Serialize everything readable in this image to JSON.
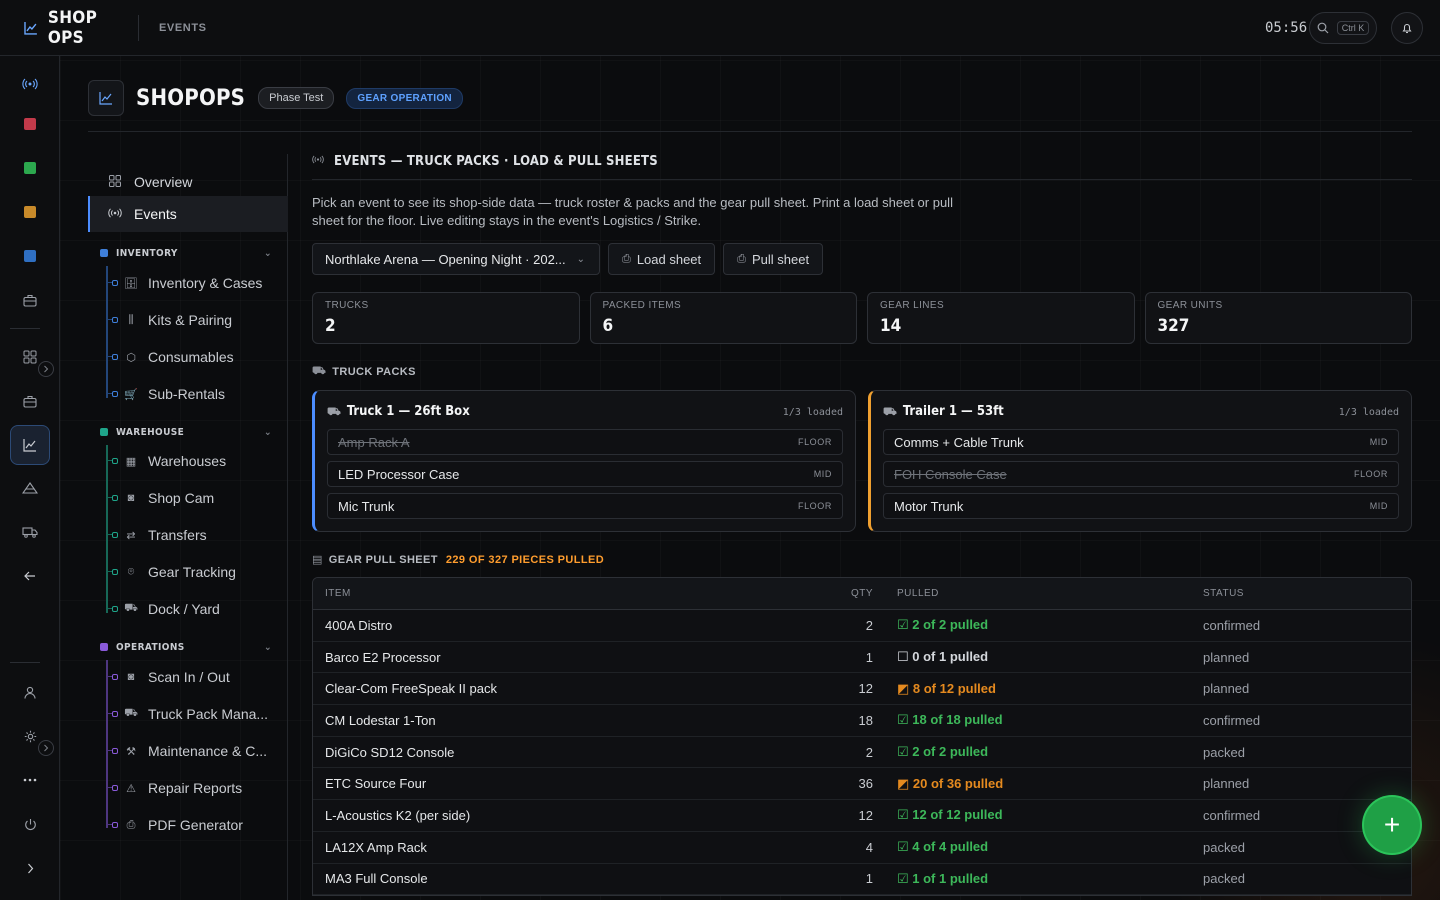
{
  "app": {
    "name": "SHOP OPS",
    "breadcrumb": "EVENTS",
    "clock": "05:56",
    "search_kbd": "Ctrl K"
  },
  "header": {
    "title": "SHOPOPS",
    "chip": "Phase Test",
    "badge": "GEAR OPERATION"
  },
  "nav": {
    "top": [
      {
        "label": "Overview",
        "icon": "grid-icon"
      },
      {
        "label": "Events",
        "icon": "broadcast-icon"
      }
    ],
    "groups": [
      {
        "label": "INVENTORY",
        "color": "#3f7fd9",
        "items": [
          "Inventory & Cases",
          "Kits & Pairing",
          "Consumables",
          "Sub-Rentals"
        ]
      },
      {
        "label": "WAREHOUSE",
        "color": "#1fa58a",
        "items": [
          "Warehouses",
          "Shop Cam",
          "Transfers",
          "Gear Tracking",
          "Dock / Yard"
        ]
      },
      {
        "label": "OPERATIONS",
        "color": "#8a5ad9",
        "items": [
          "Scan In / Out",
          "Truck Pack Mana...",
          "Maintenance & C...",
          "Repair Reports",
          "PDF Generator"
        ]
      }
    ]
  },
  "section": {
    "title": "EVENTS — TRUCK PACKS · LOAD & PULL SHEETS",
    "description": "Pick an event to see its shop-side data — truck roster & packs and the gear pull sheet. Print a load sheet or pull sheet for the floor. Live editing stays in the event's Logistics / Strike.",
    "event_select": "Northlake Arena — Opening Night · 202...",
    "load_sheet": "Load sheet",
    "pull_sheet": "Pull sheet"
  },
  "stats": [
    {
      "label": "TRUCKS",
      "value": "2"
    },
    {
      "label": "PACKED ITEMS",
      "value": "6"
    },
    {
      "label": "GEAR LINES",
      "value": "14"
    },
    {
      "label": "GEAR UNITS",
      "value": "327"
    }
  ],
  "truck_packs": {
    "label": "TRUCK PACKS",
    "trucks": [
      {
        "name": "Truck 1 — 26ft Box",
        "count": "1/3 loaded",
        "cases": [
          {
            "name": "Amp Rack A",
            "pos": "FLOOR",
            "loaded": true
          },
          {
            "name": "LED Processor Case",
            "pos": "MID",
            "loaded": false
          },
          {
            "name": "Mic Trunk",
            "pos": "FLOOR",
            "loaded": false
          }
        ]
      },
      {
        "name": "Trailer 1 — 53ft",
        "count": "1/3 loaded",
        "cases": [
          {
            "name": "Comms + Cable Trunk",
            "pos": "MID",
            "loaded": false
          },
          {
            "name": "FOH Console Case",
            "pos": "FLOOR",
            "loaded": true
          },
          {
            "name": "Motor Trunk",
            "pos": "MID",
            "loaded": false
          }
        ]
      }
    ]
  },
  "pull_sheet": {
    "label": "GEAR PULL SHEET",
    "summary": "229 OF 327 PIECES PULLED",
    "columns": {
      "item": "ITEM",
      "qty": "QTY",
      "pulled": "PULLED",
      "status": "STATUS"
    },
    "rows": [
      {
        "item": "400A Distro",
        "qty": "2",
        "pulled": "☑ 2 of 2 pulled",
        "state": "full",
        "status": "confirmed"
      },
      {
        "item": "Barco E2 Processor",
        "qty": "1",
        "pulled": "☐ 0 of 1 pulled",
        "state": "none",
        "status": "planned"
      },
      {
        "item": "Clear-Com FreeSpeak II pack",
        "qty": "12",
        "pulled": "◩ 8 of 12 pulled",
        "state": "partial",
        "status": "planned"
      },
      {
        "item": "CM Lodestar 1-Ton",
        "qty": "18",
        "pulled": "☑ 18 of 18 pulled",
        "state": "full",
        "status": "confirmed"
      },
      {
        "item": "DiGiCo SD12 Console",
        "qty": "2",
        "pulled": "☑ 2 of 2 pulled",
        "state": "full",
        "status": "packed"
      },
      {
        "item": "ETC Source Four",
        "qty": "36",
        "pulled": "◩ 20 of 36 pulled",
        "state": "partial",
        "status": "planned"
      },
      {
        "item": "L-Acoustics K2 (per side)",
        "qty": "12",
        "pulled": "☑ 12 of 12 pulled",
        "state": "full",
        "status": "confirmed"
      },
      {
        "item": "LA12X Amp Rack",
        "qty": "4",
        "pulled": "☑ 4 of 4 pulled",
        "state": "full",
        "status": "packed"
      },
      {
        "item": "MA3 Full Console",
        "qty": "1",
        "pulled": "☑ 1 of 1 pulled",
        "state": "full",
        "status": "packed"
      }
    ]
  },
  "fab": {
    "label": "+"
  },
  "colors": {
    "accent": "#4c8dff",
    "success": "#3db85a",
    "warning": "#e58a1f"
  }
}
